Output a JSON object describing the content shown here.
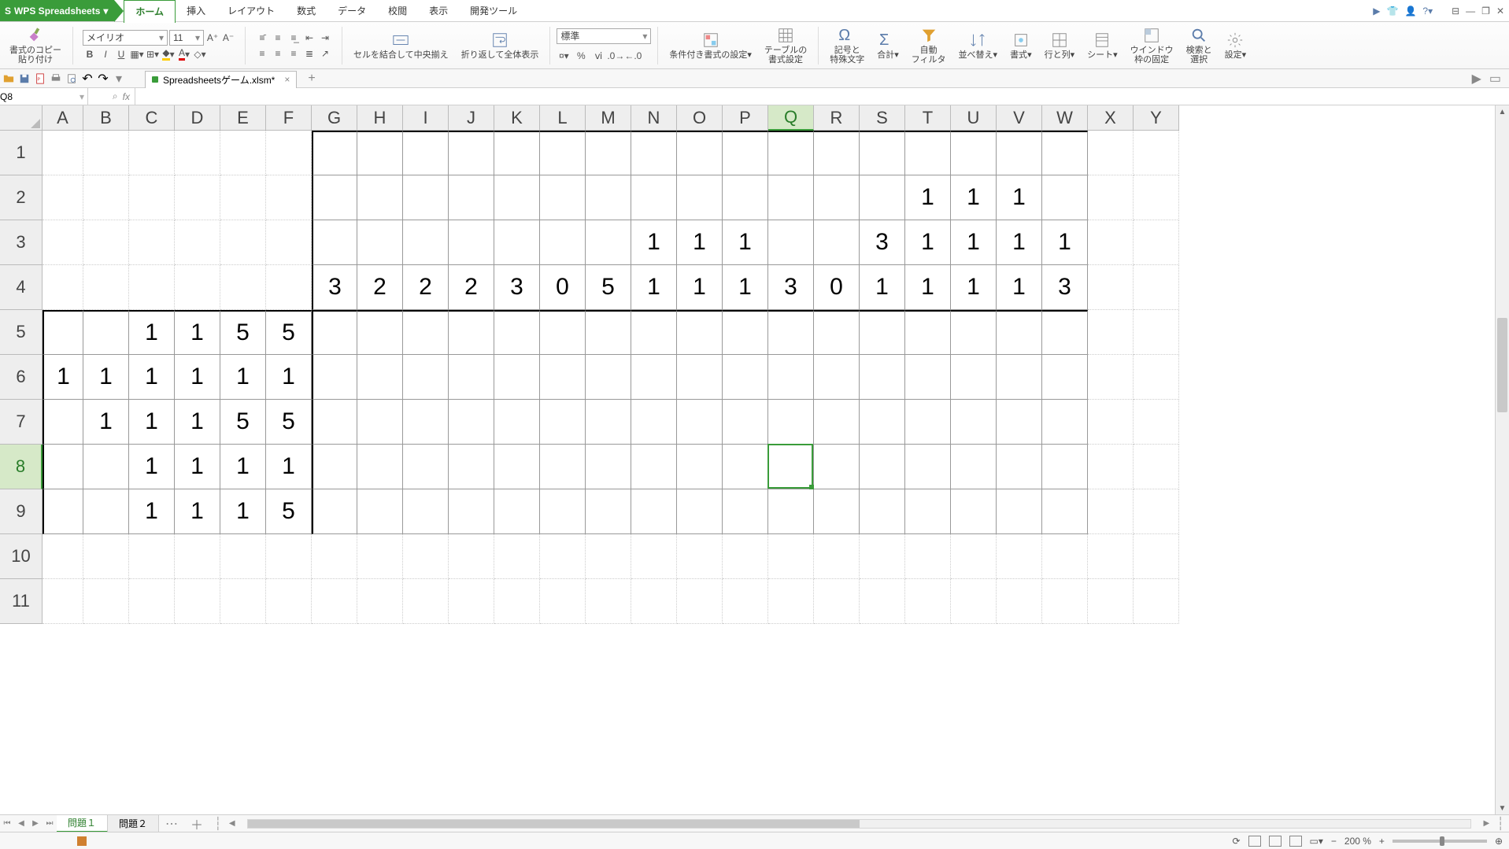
{
  "app": {
    "title": "WPS Spreadsheets"
  },
  "menu": {
    "items": [
      "ホーム",
      "挿入",
      "レイアウト",
      "数式",
      "データ",
      "校閲",
      "表示",
      "開発ツール"
    ],
    "active": 0
  },
  "ribbon": {
    "clipboard": "書式のコピー\n貼り付け",
    "font_name": "メイリオ",
    "font_size": "11",
    "merge": "セルを結合して中央揃え",
    "wrap": "折り返して全体表示",
    "number_format": "標準",
    "cond": "条件付き書式の設定",
    "table": "テーブルの\n書式設定",
    "symbol": "記号と\n特殊文字",
    "sum": "合計",
    "filter": "自動\nフィルタ",
    "sort": "並べ替え",
    "format": "書式",
    "rowcol": "行と列",
    "sheet": "シート",
    "freeze": "ウインドウ\n枠の固定",
    "find": "検索と\n選択",
    "settings": "設定"
  },
  "doc_tab": "Spreadsheetsゲーム.xlsm*",
  "namebox": "Q8",
  "columns": [
    "A",
    "B",
    "C",
    "D",
    "E",
    "F",
    "G",
    "H",
    "I",
    "J",
    "K",
    "L",
    "M",
    "N",
    "O",
    "P",
    "Q",
    "R",
    "S",
    "T",
    "U",
    "V",
    "W",
    "X",
    "Y"
  ],
  "sel_col_index": 16,
  "rows": [
    "1",
    "2",
    "3",
    "4",
    "5",
    "6",
    "7",
    "8",
    "9",
    "10",
    "11"
  ],
  "sel_row_index": 7,
  "col_hints": {
    "r2": {
      "T": "1",
      "U": "1",
      "V": "1"
    },
    "r3": {
      "N": "1",
      "O": "1",
      "P": "1",
      "S": "3",
      "T": "1",
      "U": "1",
      "V": "1",
      "W": "1"
    },
    "r4": {
      "G": "3",
      "H": "2",
      "I": "2",
      "J": "2",
      "K": "3",
      "L": "0",
      "M": "5",
      "N": "1",
      "O": "1",
      "P": "1",
      "Q": "3",
      "R": "0",
      "S": "1",
      "T": "1",
      "U": "1",
      "V": "1",
      "W": "3"
    }
  },
  "row_hints": {
    "r5": {
      "C": "1",
      "D": "1",
      "E": "5",
      "F": "5"
    },
    "r6": {
      "A": "1",
      "B": "1",
      "C": "1",
      "D": "1",
      "E": "1",
      "F": "1"
    },
    "r7": {
      "B": "1",
      "C": "1",
      "D": "1",
      "E": "5",
      "F": "5"
    },
    "r8": {
      "C": "1",
      "D": "1",
      "E": "1",
      "F": "1"
    },
    "r9": {
      "C": "1",
      "D": "1",
      "E": "1",
      "F": "5"
    }
  },
  "sheets": {
    "tabs": [
      "問題１",
      "問題２"
    ],
    "active": 0
  },
  "status": {
    "zoom": "200 %"
  }
}
